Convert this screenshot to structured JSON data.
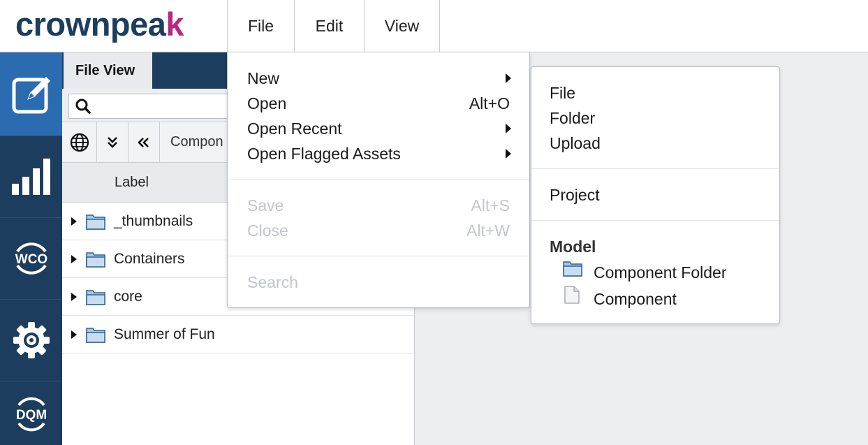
{
  "brand": {
    "logo_main": "crownpea",
    "logo_k": "k"
  },
  "menubar": {
    "file": "File",
    "edit": "Edit",
    "view": "View"
  },
  "rail": [
    {
      "name": "edit-icon"
    },
    {
      "name": "reports-icon"
    },
    {
      "name": "wco-icon",
      "label": "WCO"
    },
    {
      "name": "settings-icon"
    },
    {
      "name": "dqm-icon",
      "label": "DQM"
    }
  ],
  "panel": {
    "tab": "File View",
    "search_placeholder": "",
    "breadcrumb": "Compon",
    "column_label": "Label",
    "rows": [
      {
        "label": "_thumbnails"
      },
      {
        "label": "Containers"
      },
      {
        "label": "core"
      },
      {
        "label": "Summer of Fun"
      }
    ]
  },
  "file_menu": {
    "new": "New",
    "open": "Open",
    "open_shortcut": "Alt+O",
    "open_recent": "Open Recent",
    "open_flagged": "Open Flagged Assets",
    "save": "Save",
    "save_shortcut": "Alt+S",
    "close": "Close",
    "close_shortcut": "Alt+W",
    "search": "Search"
  },
  "new_submenu": {
    "file": "File",
    "folder": "Folder",
    "upload": "Upload",
    "project": "Project",
    "model_heading": "Model",
    "component_folder": "Component Folder",
    "component": "Component"
  },
  "colors": {
    "navy": "#1d3d5e",
    "active_blue": "#2b6cb0",
    "brand_magenta": "#b9277f",
    "disabled_text": "#c2c6cb"
  }
}
